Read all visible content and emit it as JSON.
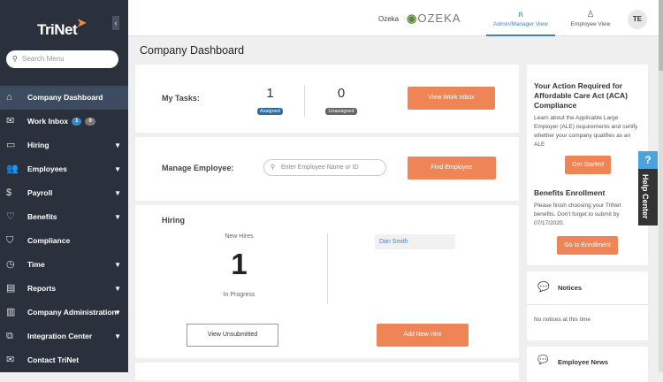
{
  "sidebar": {
    "logo": "TriNet",
    "search_placeholder": "Search Menu",
    "items": [
      {
        "label": "Company Dashboard",
        "icon": "home-icon",
        "glyph": "⌂"
      },
      {
        "label": "Work Inbox",
        "icon": "inbox-icon",
        "glyph": "✉",
        "badges": [
          "1",
          "0"
        ]
      },
      {
        "label": "Hiring",
        "icon": "briefcase-icon",
        "glyph": "▭"
      },
      {
        "label": "Employees",
        "icon": "people-icon",
        "glyph": "👥"
      },
      {
        "label": "Payroll",
        "icon": "dollar-icon",
        "glyph": "$"
      },
      {
        "label": "Benefits",
        "icon": "heart-icon",
        "glyph": "♡"
      },
      {
        "label": "Compliance",
        "icon": "shield-icon",
        "glyph": "⛉"
      },
      {
        "label": "Time",
        "icon": "clock-icon",
        "glyph": "◷"
      },
      {
        "label": "Reports",
        "icon": "report-icon",
        "glyph": "▤"
      },
      {
        "label": "Company Administration",
        "icon": "building-icon",
        "glyph": "▥"
      },
      {
        "label": "Integration Center",
        "icon": "integration-icon",
        "glyph": "⧉"
      },
      {
        "label": "Contact TriNet",
        "icon": "mail-icon",
        "glyph": "✉"
      }
    ]
  },
  "header": {
    "company": "Ozeka",
    "company_logo": "OZEKA",
    "admin_view": "Admin/Manager View",
    "employee_view": "Employee View",
    "avatar": "TE"
  },
  "main": {
    "title": "Company Dashboard",
    "tasks": {
      "label": "My Tasks:",
      "assigned_count": "1",
      "assigned_label": "Assigned",
      "unassigned_count": "0",
      "unassigned_label": "Unassigned",
      "button": "View Work Inbox"
    },
    "manage": {
      "label": "Manage Employee:",
      "placeholder": "Enter Employee Name or ID",
      "button": "Find Employee"
    },
    "hiring": {
      "title": "Hiring",
      "new_hires": "New Hires",
      "count": "1",
      "status": "In Progress",
      "name": "Dan Smith",
      "view_unsubmitted": "View Unsubmitted",
      "add_new_hire": "Add New Hire"
    }
  },
  "right": {
    "aca_title": "Your Action Required for Affordable Care Act (ACA) Compliance",
    "aca_text": "Learn about the Applicable Large Employer (ALE) requirements and certify whether your company qualifies as an ALE",
    "get_started": "Get Started",
    "benefits_title": "Benefits Enrollment",
    "benefits_text": "Please finish choosing your TriNet benefits. Don't forget to submit by 07/17/2020.",
    "go_enrollment": "Go to Enrollment",
    "notices_title": "Notices",
    "notices_text": "No notices at this time",
    "news_title": "Employee News"
  },
  "help": {
    "q": "?",
    "label": "Help Center"
  },
  "colors": {
    "sidebar": "#2a313d",
    "accent": "#ef8556",
    "link": "#3b86c7"
  }
}
